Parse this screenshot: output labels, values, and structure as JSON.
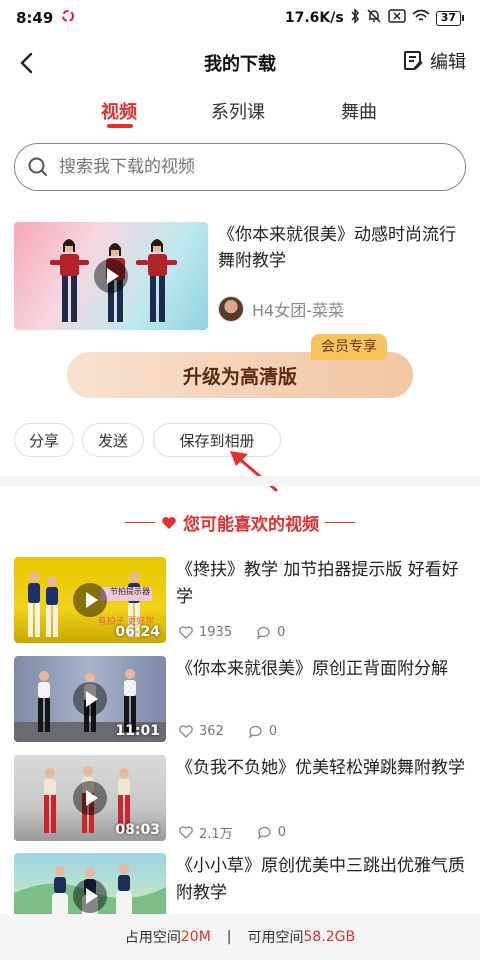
{
  "status_bar": {
    "time": "8:49",
    "speed": "17.6K/s",
    "battery": "37"
  },
  "header": {
    "title": "我的下载",
    "edit_label": "编辑"
  },
  "tabs": [
    {
      "label": "视频",
      "active": true
    },
    {
      "label": "系列课",
      "active": false
    },
    {
      "label": "舞曲",
      "active": false
    }
  ],
  "search": {
    "placeholder": "搜索我下载的视频"
  },
  "download": {
    "title": "《你本来就很美》动感时尚流行舞附教学",
    "author": "H4女团-菜菜"
  },
  "upgrade": {
    "label": "升级为高清版",
    "badge": "会员专享"
  },
  "actions": {
    "share": "分享",
    "send": "发送",
    "save_album": "保存到相册"
  },
  "recommend": {
    "header": "您可能喜欢的视频",
    "items": [
      {
        "title": "《搀扶》教学 加节拍器提示版 好看好学",
        "duration": "06:24",
        "likes": "1935",
        "comments": "0",
        "thumb_text": "节拍提示器"
      },
      {
        "title": "《你本来就很美》原创正背面附分解",
        "duration": "11:01",
        "likes": "362",
        "comments": "0"
      },
      {
        "title": "《负我不负她》优美轻松弹跳舞附教学",
        "duration": "08:03",
        "likes": "2.1万",
        "comments": "0"
      },
      {
        "title": "《小小草》原创优美中三跳出优雅气质附教学",
        "duration": "",
        "likes": "",
        "comments": ""
      }
    ]
  },
  "storage": {
    "used_label": "占用空间",
    "used_value": "20M",
    "separator": "|",
    "free_label": "可用空间",
    "free_value": "58.2GB"
  },
  "colors": {
    "accent": "#e0312e",
    "vip": "#f5c45d"
  }
}
